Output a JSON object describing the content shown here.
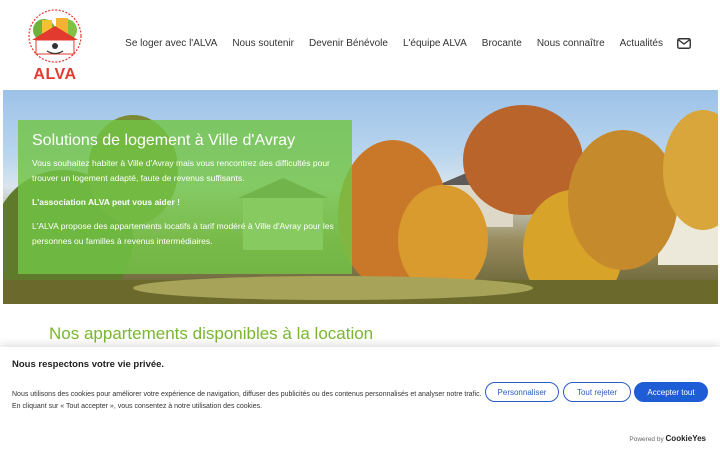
{
  "site": {
    "logo_text": "ALVA",
    "logo_ring_text": "ASSOCIATION LOGEMENT VILLE D'AVRAY"
  },
  "nav": {
    "items": [
      {
        "label": "Se loger avec l'ALVA"
      },
      {
        "label": "Nous soutenir"
      },
      {
        "label": "Devenir Bénévole"
      },
      {
        "label": "L'équipe ALVA"
      },
      {
        "label": "Brocante"
      },
      {
        "label": "Nous connaître"
      },
      {
        "label": "Actualités"
      }
    ],
    "contact_icon": "mail-icon"
  },
  "hero": {
    "title": "Solutions de logement à Ville d'Avray",
    "paragraph1": "Vous souhaitez habiter à Ville d'Avray mais vous rencontrez des difficultés pour trouver un logement adapté, faute de revenus suffisants.",
    "paragraph2": "L'association ALVA peut vous aider !",
    "paragraph3": "L'ALVA propose des appartements locatifs à tarif modéré à Ville d'Avray pour les personnes ou familles à revenus intermédiaires.",
    "overlay_color": "#72c446"
  },
  "main": {
    "section_title": "Nos appartements disponibles à la location"
  },
  "cookie": {
    "title": "Nous respectons votre vie privée.",
    "description": "Nous utilisons des cookies pour améliorer votre expérience de navigation, diffuser des publicités ou des contenus personnalisés et analyser notre trafic. En cliquant sur « Tout accepter », vous consentez à notre utilisation des cookies.",
    "customize_label": "Personnaliser",
    "reject_label": "Tout rejeter",
    "accept_label": "Accepter tout",
    "powered_by": "Powered by",
    "brand": "CookieYes",
    "accent": "#1e5dd6"
  }
}
